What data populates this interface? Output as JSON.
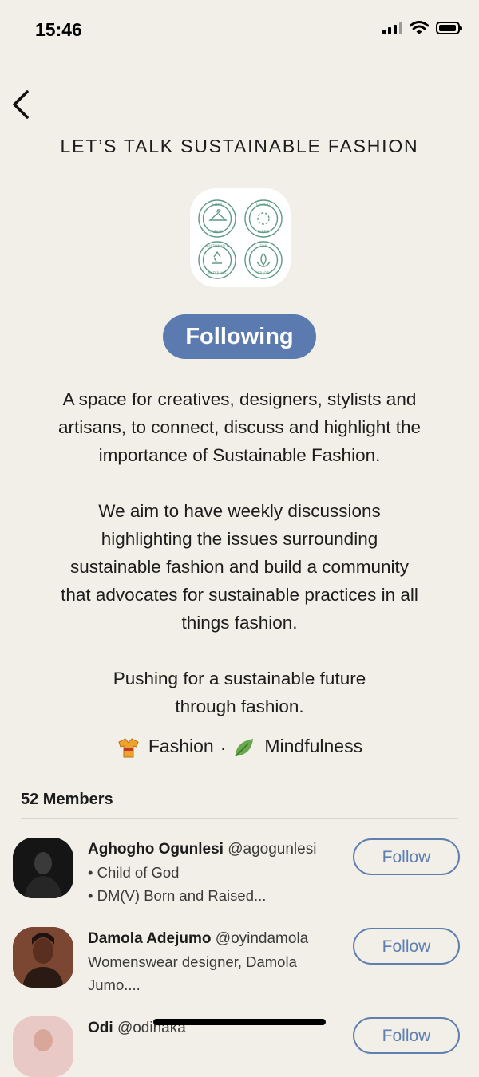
{
  "status_bar": {
    "time": "15:46"
  },
  "club": {
    "title": "LET’S TALK SUSTAINABLE FASHION",
    "logo_badges": [
      {
        "top": "SLOW",
        "bottom": "FASHION"
      },
      {
        "top": "ETHICAL",
        "bottom": "FABRIC"
      },
      {
        "top": "SUSTAINABLE",
        "bottom": "MATERIALS"
      },
      {
        "top": "FAIR",
        "bottom": "TRADE"
      }
    ],
    "follow_state_label": "Following",
    "description": [
      [
        "A space for creatives, designers, stylists and",
        "artisans, to connect, discuss and highlight the",
        "importance of Sustainable Fashion."
      ],
      [
        "We aim to have weekly discussions",
        "highlighting the issues surrounding",
        "sustainable fashion and build a community",
        "that advocates for sustainable practices in all",
        "things fashion."
      ],
      [
        "Pushing for a sustainable future",
        "through fashion."
      ]
    ],
    "topics": [
      {
        "icon": "kimono-icon",
        "label": "Fashion"
      },
      {
        "icon": "leaf-icon",
        "label": "Mindfulness"
      }
    ],
    "topic_separator": "·",
    "members_count_label": "52 Members"
  },
  "members": [
    {
      "name": "Aghogho Ogunlesi",
      "handle": "@agogunlesi",
      "bio": [
        "• Child of God",
        "• DM(V) Born and Raised..."
      ],
      "follow_label": "Follow"
    },
    {
      "name": "Damola Adejumo",
      "handle": "@oyindamola",
      "bio": [
        "Womenswear designer, Damola",
        "Jumo...."
      ],
      "follow_label": "Follow"
    },
    {
      "name": "Odi",
      "handle": "@odinaka",
      "bio": [],
      "follow_label": "Follow"
    }
  ],
  "colors": {
    "background": "#f1efe7",
    "accent": "#5b7bb0",
    "badge_green": "#5f9a85"
  }
}
